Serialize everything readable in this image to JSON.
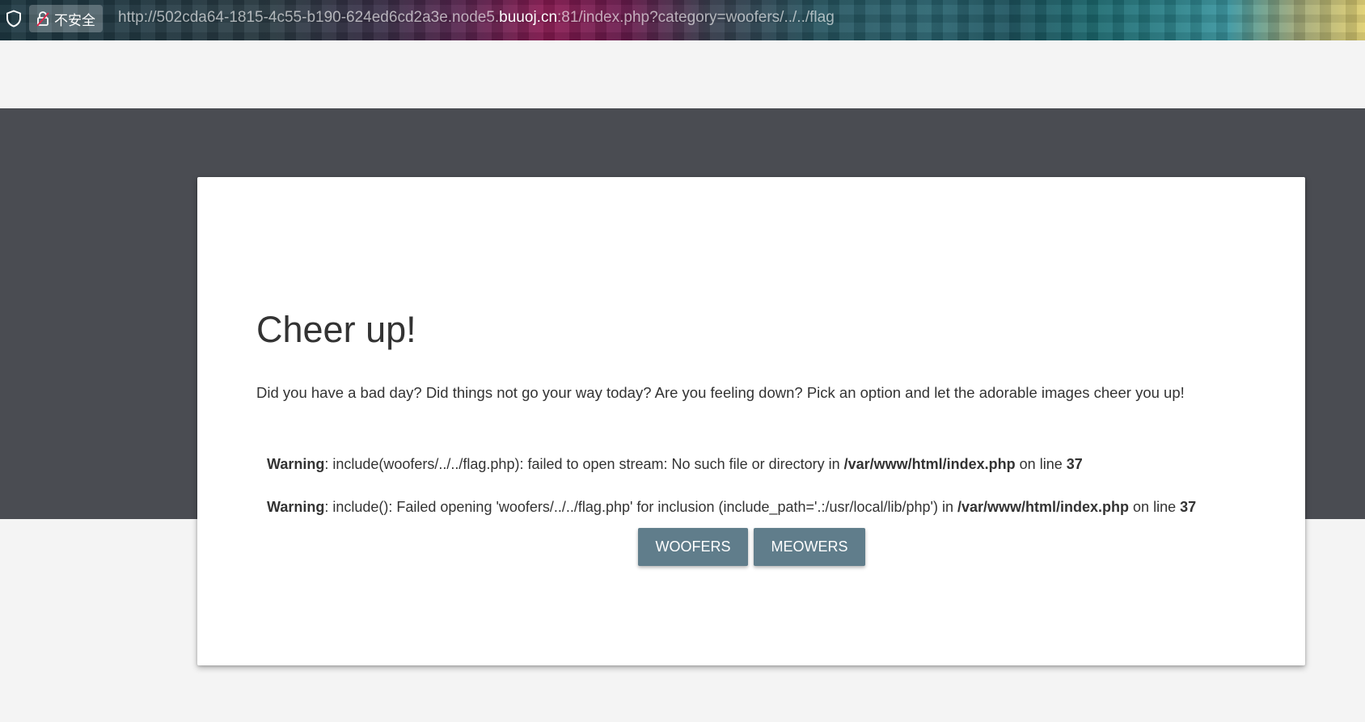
{
  "browser": {
    "security_label": "不安全",
    "url": {
      "prefix": "http://502cda64-1815-4c55-b190-624ed6cd2a3e.node5.",
      "host": "buuoj.cn",
      "suffix": ":81/index.php?category=woofers/../../flag"
    }
  },
  "page": {
    "title": "Cheer up!",
    "intro": "Did you have a bad day? Did things not go your way today? Are you feeling down? Pick an option and let the adorable images cheer you up!",
    "warnings": [
      {
        "label": "Warning",
        "message": ": include(woofers/../../flag.php): failed to open stream: No such file or directory in ",
        "file": "/var/www/html/index.php",
        "line_text": " on line ",
        "line": "37"
      },
      {
        "label": "Warning",
        "message": ": include(): Failed opening 'woofers/../../flag.php' for inclusion (include_path='.:/usr/local/lib/php') in ",
        "file": "/var/www/html/index.php",
        "line_text": " on line ",
        "line": "37"
      }
    ],
    "buttons": {
      "woofers": "WOOFERS",
      "meowers": "MEOWERS"
    }
  },
  "colors": {
    "hero_band": "#4a4c52",
    "page_background": "#f4f4f4",
    "button": "#607d8b",
    "card": "#ffffff"
  }
}
